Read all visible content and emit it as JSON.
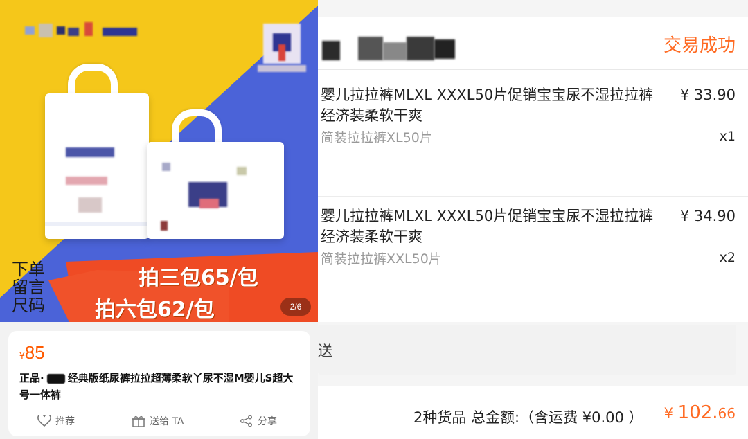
{
  "product_card": {
    "hero": {
      "side_note_lines": [
        "下单",
        "留言",
        "尺码"
      ],
      "promo_line1": "拍三包65/包",
      "promo_line2": "拍六包62/包",
      "pager": "2/6"
    },
    "price_symbol": "¥",
    "price_value": "85",
    "title_part1": "正品·",
    "title_part2": "经典版纸尿裤拉拉超薄柔软丫尿不湿M婴儿S超大号一体裤",
    "actions": [
      {
        "label": "推荐",
        "icon": "heart-icon"
      },
      {
        "label": "送给 TA",
        "icon": "gift-icon"
      },
      {
        "label": "分享",
        "icon": "share-icon"
      }
    ]
  },
  "order": {
    "status": "交易成功",
    "items": [
      {
        "name": "婴儿拉拉裤MLXL XXXL50片促销宝宝尿不湿拉拉裤经济装柔软干爽",
        "price": "¥ 33.90",
        "spec": "简装拉拉裤XL50片",
        "qty": "x1"
      },
      {
        "name": "婴儿拉拉裤MLXL XXXL50片促销宝宝尿不湿拉拉裤经济装柔软干爽",
        "price": "¥ 34.90",
        "spec": "简装拉拉裤XXL50片",
        "qty": "x2"
      }
    ],
    "shipping_text": "送",
    "summary_label": "2种货品 总金额:（含运费 ¥0.00 ）",
    "total_symbol": "¥ ",
    "total_int": "102.",
    "total_dec": "66"
  },
  "colors": {
    "accent_orange": "#ff6a22",
    "hero_yellow": "#f5c71a",
    "hero_blue": "#4b63d8",
    "promo_red": "#f0522a"
  }
}
